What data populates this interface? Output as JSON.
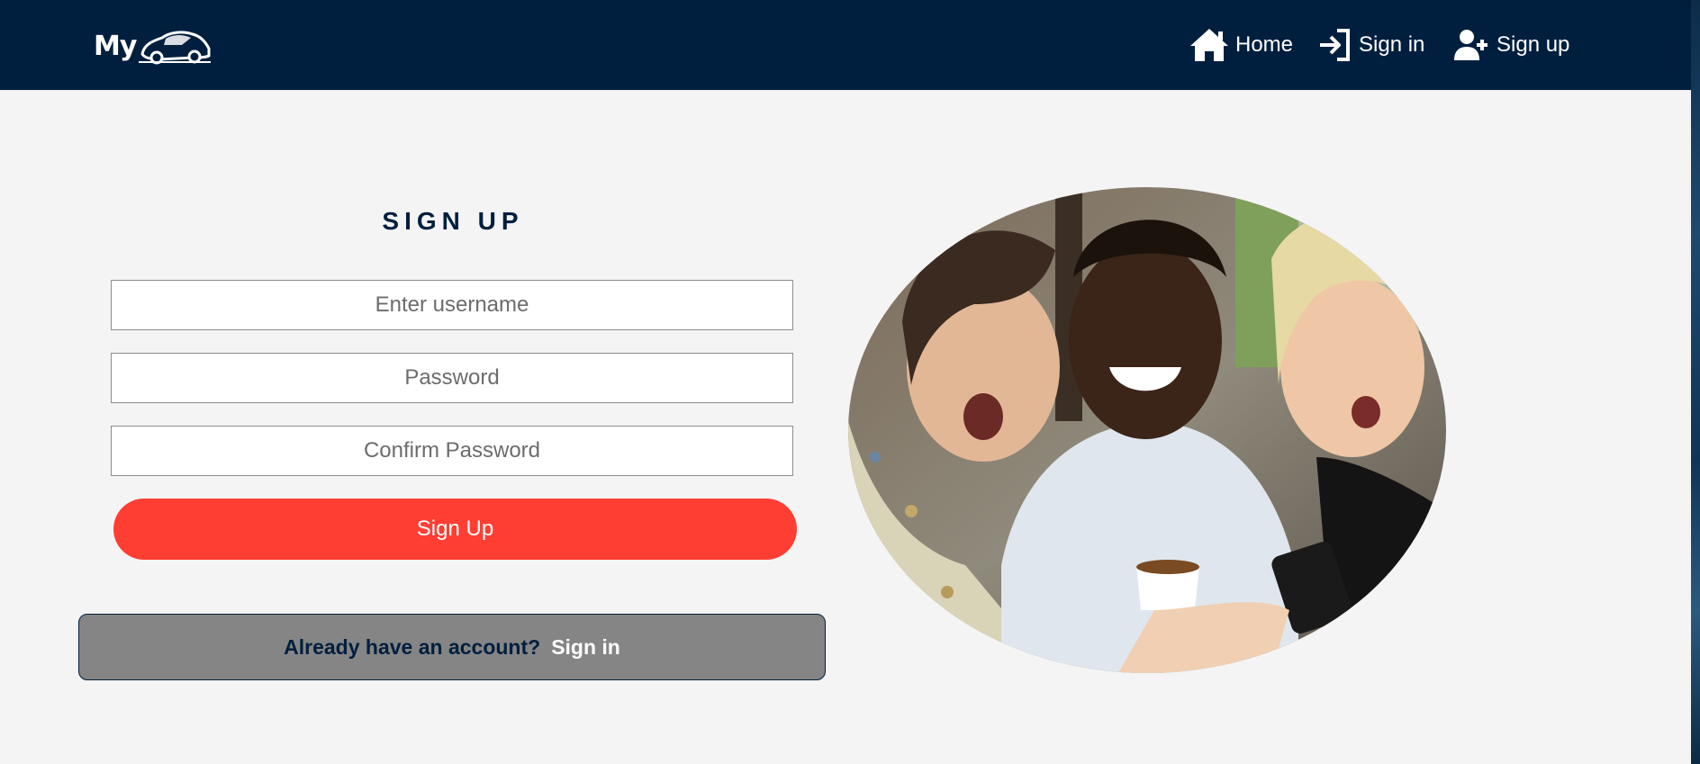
{
  "navbar": {
    "logo_text": "My",
    "items": [
      {
        "label": "Home",
        "icon": "home-icon"
      },
      {
        "label": "Sign in",
        "icon": "sign-in-icon"
      },
      {
        "label": "Sign up",
        "icon": "user-plus-icon"
      }
    ]
  },
  "form": {
    "title": "SIGN UP",
    "username_placeholder": "Enter username",
    "password_placeholder": "Password",
    "confirm_placeholder": "Confirm Password",
    "submit_label": "Sign Up"
  },
  "account_prompt": {
    "text": "Already have an account?",
    "link": "Sign in"
  },
  "colors": {
    "navbar": "#001f3f",
    "accent": "#ff3e33",
    "background": "#f4f4f4",
    "prompt_box": "#858585"
  }
}
